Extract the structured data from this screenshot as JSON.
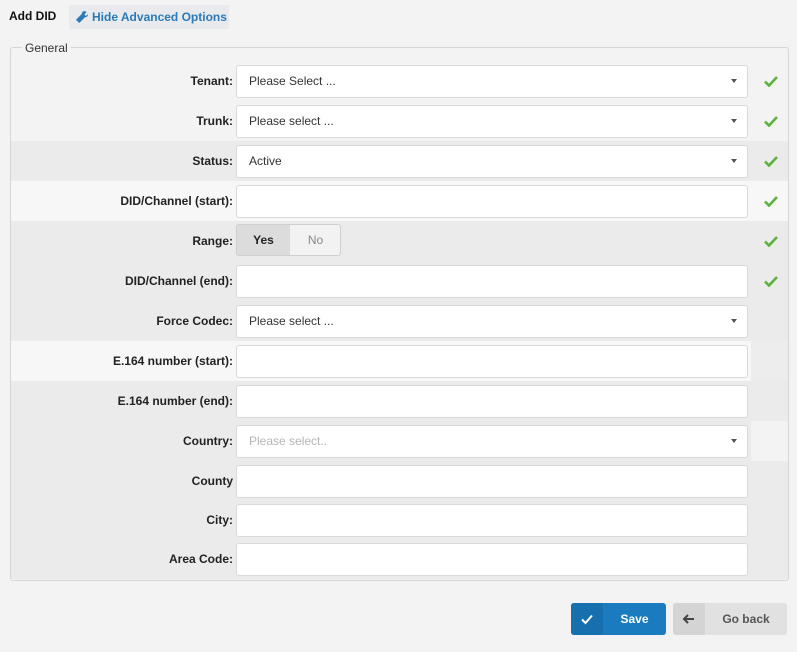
{
  "tabs": {
    "active": "Add DID",
    "advanced": "Hide Advanced Options"
  },
  "fieldset": {
    "legend": "General"
  },
  "fields": {
    "tenant": {
      "label": "Tenant:",
      "value": "Please Select ...",
      "valid": true
    },
    "trunk": {
      "label": "Trunk:",
      "value": "Please select ...",
      "valid": true
    },
    "status": {
      "label": "Status:",
      "value": "Active",
      "valid": true
    },
    "did_start": {
      "label": "DID/Channel (start):",
      "value": "",
      "valid": true
    },
    "range": {
      "label": "Range:",
      "yes": "Yes",
      "no": "No",
      "selected": "Yes",
      "valid": true
    },
    "did_end": {
      "label": "DID/Channel (end):",
      "value": "",
      "valid": true
    },
    "force_codec": {
      "label": "Force Codec:",
      "value": "Please select ..."
    },
    "e164_start": {
      "label": "E.164 number (start):",
      "value": ""
    },
    "e164_end": {
      "label": "E.164 number (end):",
      "value": ""
    },
    "country": {
      "label": "Country:",
      "placeholder": "Please select.."
    },
    "county": {
      "label": "County",
      "value": ""
    },
    "city": {
      "label": "City:",
      "value": ""
    },
    "area_code": {
      "label": "Area Code:",
      "value": ""
    }
  },
  "buttons": {
    "save": "Save",
    "back": "Go back"
  },
  "colors": {
    "primary": "#1a7bbf",
    "valid_check": "#5bb13e",
    "link": "#2a7ab8"
  }
}
